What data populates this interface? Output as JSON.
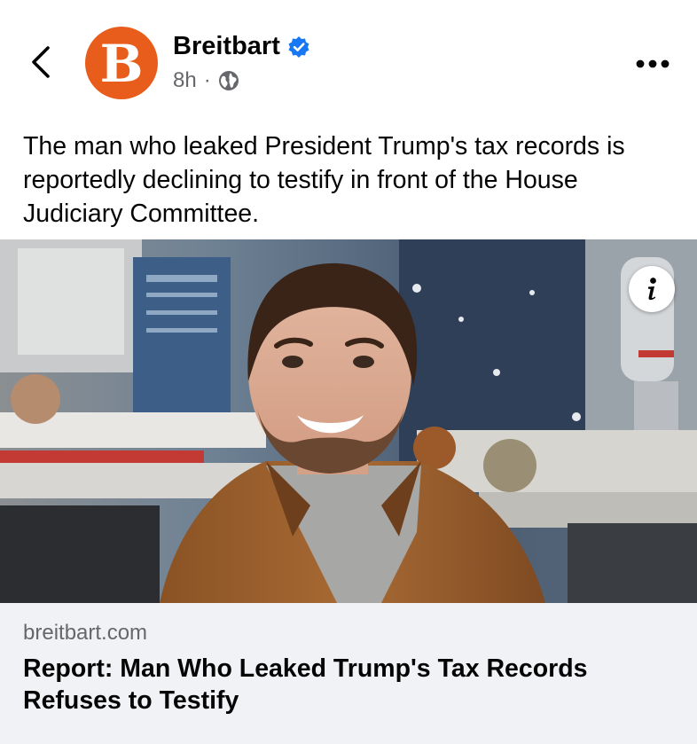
{
  "post": {
    "page_name": "Breitbart",
    "avatar_letter": "B",
    "time": "8h",
    "separator": "·",
    "caption": "The man who leaked President Trump's tax records is reportedly declining to testify in front of the House Judiciary Committee."
  },
  "link_preview": {
    "domain": "breitbart.com",
    "headline": "Report: Man Who Leaked Trump's Tax Records Refuses to Testify"
  },
  "icons": {
    "back": "chevron-left-icon",
    "verified": "verified-badge-icon",
    "audience": "globe-icon",
    "more": "more-horizontal-icon",
    "info": "info-icon"
  },
  "colors": {
    "brand": "#e85d1c",
    "verified": "#1877f2",
    "secondary_text": "#65676b",
    "preview_bg": "#f0f2f5"
  }
}
